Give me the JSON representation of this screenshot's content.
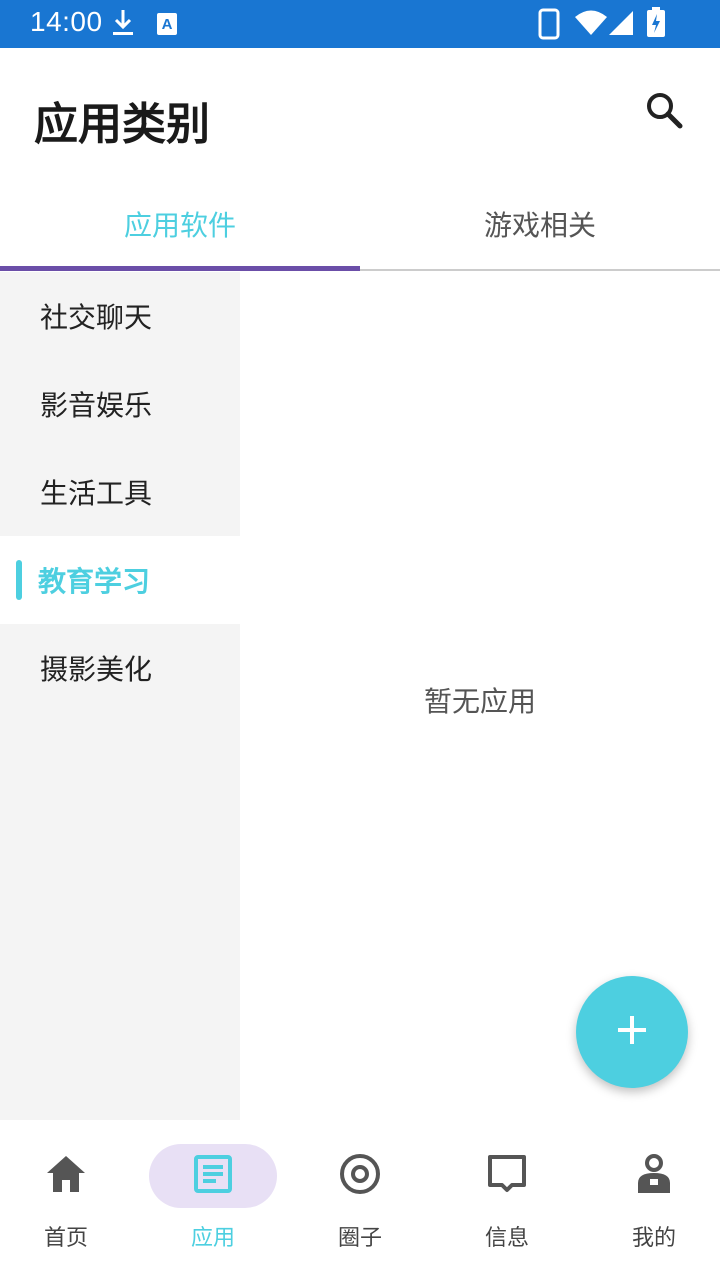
{
  "status_bar": {
    "time": "14:00",
    "icons": [
      "download-icon",
      "accessibility-icon",
      "phone-icon",
      "wifi-icon",
      "signal-icon",
      "battery-charging-icon"
    ]
  },
  "header": {
    "title": "应用类别",
    "search_icon": "search-icon"
  },
  "tabs": [
    {
      "label": "应用软件",
      "selected": true
    },
    {
      "label": "游戏相关",
      "selected": false
    }
  ],
  "categories": [
    {
      "label": "社交聊天",
      "selected": false
    },
    {
      "label": "影音娱乐",
      "selected": false
    },
    {
      "label": "生活工具",
      "selected": false
    },
    {
      "label": "教育学习",
      "selected": true
    },
    {
      "label": "摄影美化",
      "selected": false
    }
  ],
  "content": {
    "empty_text": "暂无应用"
  },
  "fab": {
    "icon": "plus-icon"
  },
  "bottom_nav": [
    {
      "label": "首页",
      "icon": "home-icon",
      "selected": false
    },
    {
      "label": "应用",
      "icon": "apps-icon",
      "selected": true
    },
    {
      "label": "圈子",
      "icon": "circle-icon",
      "selected": false
    },
    {
      "label": "信息",
      "icon": "message-icon",
      "selected": false
    },
    {
      "label": "我的",
      "icon": "profile-icon",
      "selected": false
    }
  ],
  "colors": {
    "status_bar": "#1976d2",
    "accent": "#4dcfe0",
    "tab_indicator": "#6b4ea8",
    "nav_active_bg": "#e8e0f5",
    "sidebar_bg": "#f4f4f4"
  }
}
